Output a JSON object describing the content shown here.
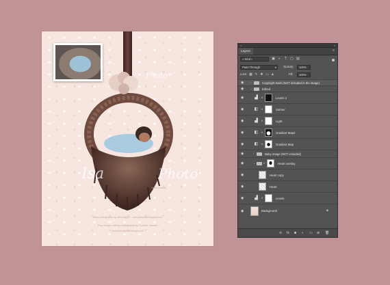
{
  "document": {
    "watermark_top": "Photo",
    "watermark_bottom_left": "Isa",
    "watermark_bottom_right": "Photo",
    "hearts_tag": "Heart Overlay",
    "credit_line_1": "Baby photography by Julia Nagy® - www.jdrevel@blogspot.com",
    "credit_line_2": "Prop design, editing, photography by Christine Hansen",
    "credit_line_3": "www.isabellphotodesign.com"
  },
  "layers_panel": {
    "tab_label": "Layers",
    "kind_label": "Kind",
    "blend_mode": "Pass Through",
    "opacity_label": "Opacity:",
    "opacity_value": "100%",
    "lock_label": "Lock:",
    "fill_label": "Fill:",
    "fill_value": "100%",
    "layers": [
      {
        "name": "Copyright mark (NOT included in the image)",
        "type": "group"
      },
      {
        "name": "Edited",
        "type": "group"
      },
      {
        "name": "Levels 2",
        "type": "adjustment"
      },
      {
        "name": "Varmer",
        "type": "adjustment"
      },
      {
        "name": "Light",
        "type": "adjustment"
      },
      {
        "name": "Gradient Map2",
        "type": "adjustment"
      },
      {
        "name": "Gradient Map",
        "type": "adjustment"
      },
      {
        "name": "Baby image (NOT included)",
        "type": "group"
      },
      {
        "name": "Heart overlay",
        "type": "group"
      },
      {
        "name": "Heart copy",
        "type": "pixel"
      },
      {
        "name": "Heart",
        "type": "pixel"
      },
      {
        "name": "Levels",
        "type": "adjustment"
      },
      {
        "name": "Background",
        "type": "background"
      }
    ]
  }
}
